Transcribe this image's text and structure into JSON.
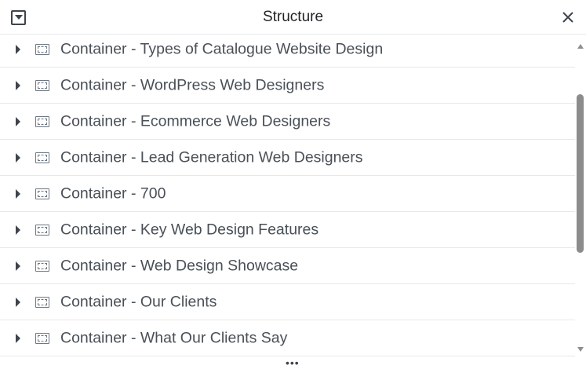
{
  "header": {
    "title": "Structure",
    "collapse_icon": "collapse-toggle-icon",
    "close_icon": "close-icon"
  },
  "rows": [
    {
      "label": "Container - Types of Catalogue Website Design"
    },
    {
      "label": "Container - WordPress Web Designers"
    },
    {
      "label": "Container - Ecommerce Web Designers"
    },
    {
      "label": "Container - Lead Generation Web Designers"
    },
    {
      "label": "Container - 700"
    },
    {
      "label": "Container - Key Web Design Features"
    },
    {
      "label": "Container - Web Design Showcase"
    },
    {
      "label": "Container - Our Clients"
    },
    {
      "label": "Container - What Our Clients Say"
    }
  ],
  "footer": {
    "more_icon": "more-horizontal-icon"
  },
  "colors": {
    "text": "#4a5057",
    "divider": "#e6e8ea",
    "thumb": "#8c8c8c"
  }
}
